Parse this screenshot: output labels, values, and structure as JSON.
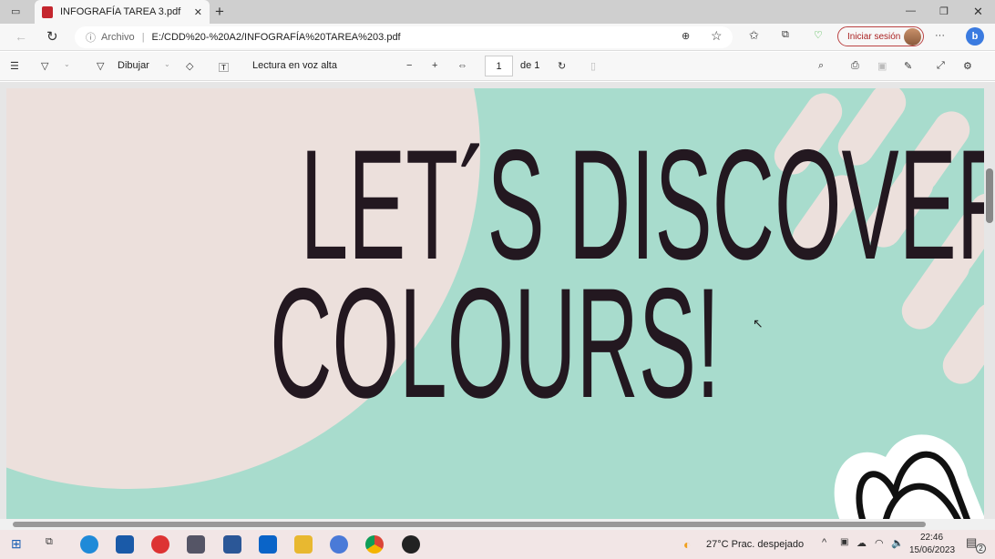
{
  "tab": {
    "title": "INFOGRAFÍA TAREA 3.pdf",
    "close": "✕",
    "new": "+"
  },
  "window": {
    "minimize": "—",
    "restore": "❐",
    "close": "✕"
  },
  "address": {
    "scheme_label": "Archivo",
    "url": "E:/CDD%20-%20A2/INFOGRAFÍA%20TAREA%203.pdf",
    "signin": "Iniciar sesión",
    "more": "···"
  },
  "toolbar": {
    "draw": "Dibujar",
    "read_aloud": "Lectura en voz alta",
    "page": "1",
    "page_of": "de 1"
  },
  "document": {
    "line1": "LET´S DISCOVER",
    "line2": "COLOURS!"
  },
  "taskbar": {
    "weather": "27°C  Prac. despejado",
    "time": "22:46",
    "date": "15/06/2023",
    "notifications": "2"
  },
  "colors": {
    "mint": "#a8dccd",
    "beige": "#ece0dc",
    "text": "#231820"
  }
}
